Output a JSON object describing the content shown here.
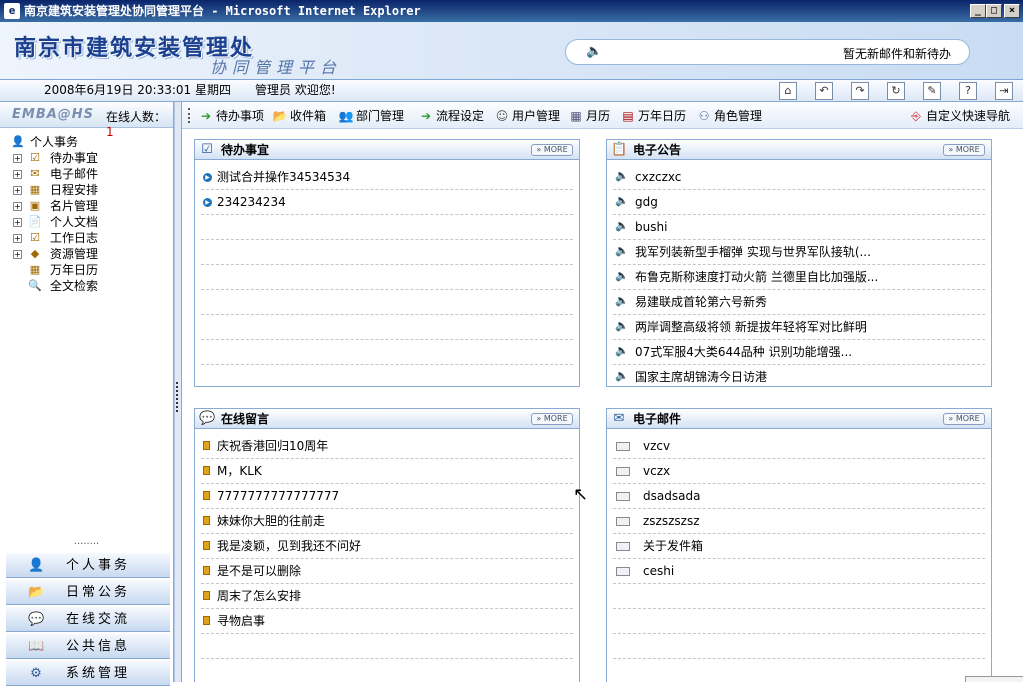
{
  "window": {
    "title": "南京建筑安装管理处协同管理平台 - Microsoft Internet Explorer",
    "controls": [
      "_",
      "□",
      "×"
    ]
  },
  "banner": {
    "logo_main": "南京市建筑安装管理处",
    "logo_sub": "协同管理平台",
    "notice": "暂无新邮件和新待办"
  },
  "status": {
    "datetime": "2008年6月19日 20:33:01 星期四",
    "user": "管理员   欢迎您!"
  },
  "toolbar_icons": [
    "home-icon",
    "back-icon",
    "forward-icon",
    "refresh-icon",
    "edit-icon",
    "help-icon",
    "logout-icon"
  ],
  "left": {
    "brand": "EMBA@HS",
    "online_label": "在线人数：",
    "online_count": "1",
    "tree": [
      {
        "label": "个人事务",
        "root": true
      },
      {
        "label": "待办事宜"
      },
      {
        "label": "电子邮件"
      },
      {
        "label": "日程安排"
      },
      {
        "label": "名片管理"
      },
      {
        "label": "个人文档"
      },
      {
        "label": "工作日志"
      },
      {
        "label": "资源管理"
      },
      {
        "label": "万年日历"
      },
      {
        "label": "全文检索"
      }
    ],
    "nav": [
      "个人事务",
      "日常公务",
      "在线交流",
      "公共信息",
      "系统管理"
    ]
  },
  "toolbar": {
    "items": [
      "待办事项",
      "收件箱",
      "部门管理",
      "流程设定",
      "用户管理",
      "月历",
      "万年日历",
      "角色管理"
    ],
    "custom_nav": "自定义快速导航"
  },
  "panels": {
    "more_label": "» MORE",
    "todo": {
      "title": "待办事宜",
      "items": [
        "测试合并操作34534534",
        "234234234"
      ]
    },
    "announce": {
      "title": "电子公告",
      "items": [
        "cxzczxc",
        "gdg",
        "bushi",
        "我军列装新型手榴弹 实现与世界军队接轨(...",
        "布鲁克斯称速度打动火箭 兰德里自比加强版...",
        "易建联成首轮第六号新秀",
        "两岸调整高级将领 新提拔年轻将军对比鲜明",
        "07式军服4大类644品种 识别功能增强...",
        "国家主席胡锦涛今日访港"
      ]
    },
    "message": {
      "title": "在线留言",
      "items": [
        "庆祝香港回归10周年",
        "M，KLK",
        "7777777777777777",
        "妹妹你大胆的往前走",
        "我是凌颖，见到我还不问好",
        "是不是可以删除",
        "周末了怎么安排",
        "寻物启事"
      ]
    },
    "mail": {
      "title": "电子邮件",
      "items": [
        "vzcv",
        "vczx",
        "dsadsada",
        "zszszszsz",
        "关于发件箱",
        "ceshi"
      ]
    }
  }
}
